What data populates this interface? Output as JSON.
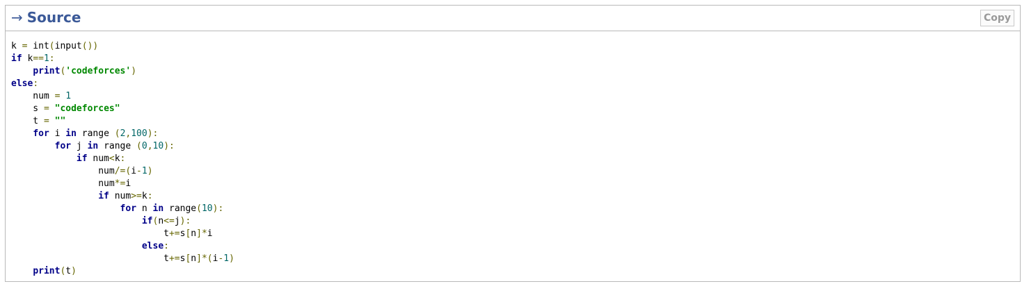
{
  "panel": {
    "title_arrow": "→",
    "title": "Source",
    "copy_label": "Copy"
  },
  "code": {
    "language": "python",
    "lines": [
      "k = int(input())",
      "if k==1:",
      "    print('codeforces')",
      "else:",
      "    num = 1",
      "    s = \"codeforces\"",
      "    t = \"\"",
      "    for i in range (2,100):",
      "        for j in range (0,10):",
      "            if num<k:",
      "                num/=(i-1)",
      "                num*=i",
      "                if num>=k:",
      "                    for n in range(10):",
      "                        if(n<=j):",
      "                            t+=s[n]*i",
      "                        else:",
      "                            t+=s[n]*(i-1)",
      "    print(t)"
    ]
  },
  "colors": {
    "title": "#3b5998",
    "keyword": "#000088",
    "string": "#008800",
    "number": "#006666",
    "punctuation": "#666600",
    "border": "#b9b9b9"
  }
}
